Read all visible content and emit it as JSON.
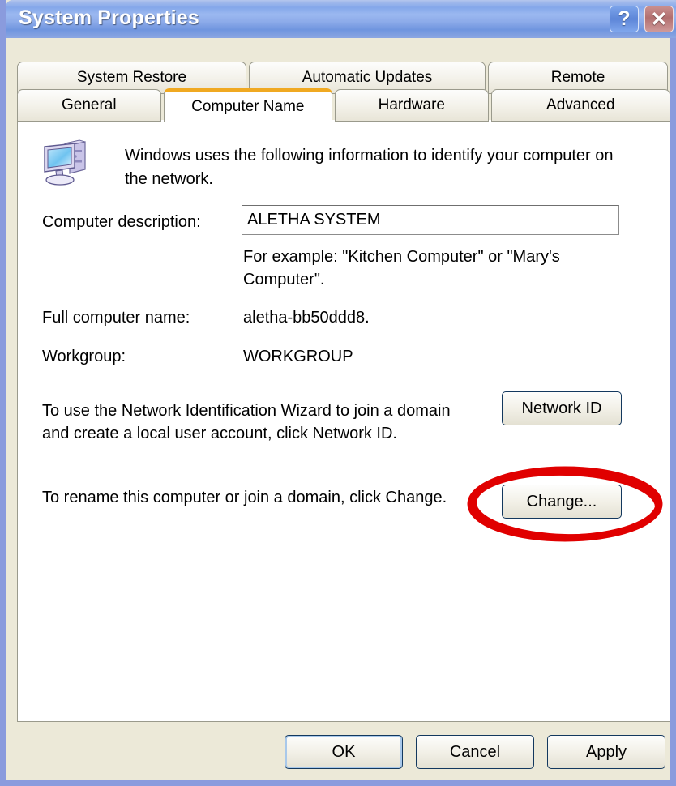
{
  "window": {
    "title": "System Properties",
    "help_button": "?",
    "close_button": "✕",
    "border_color": "#8a9bdd",
    "titlebar_color": "#7ea2e8",
    "body_color": "#ece9d8"
  },
  "tabs": {
    "active": "Computer Name",
    "active_underline_color": "#f0a921",
    "row_top": [
      {
        "label": "System Restore"
      },
      {
        "label": "Automatic Updates"
      },
      {
        "label": "Remote"
      }
    ],
    "row_bottom": [
      {
        "label": "General"
      },
      {
        "label": "Computer Name"
      },
      {
        "label": "Hardware"
      },
      {
        "label": "Advanced"
      }
    ]
  },
  "panel": {
    "icon": "computer-icon",
    "intro": "Windows uses the following information to identify your computer on the network.",
    "computer_description": {
      "label": "Computer description:",
      "value": "ALETHA SYSTEM",
      "placeholder": "",
      "hint": "For example: \"Kitchen Computer\" or \"Mary's Computer\"."
    },
    "full_computer_name": {
      "label": "Full computer name:",
      "value": "aletha-bb50ddd8."
    },
    "workgroup": {
      "label": "Workgroup:",
      "value": "WORKGROUP"
    },
    "network_id": {
      "text": "To use the Network Identification Wizard to join a domain and create a local user account, click Network ID.",
      "button": "Network ID"
    },
    "rename": {
      "text": "To rename this computer or join a domain, click Change.",
      "button": "Change..."
    }
  },
  "annotation": {
    "shape": "ellipse",
    "color": "#e00000",
    "target": "Change... button"
  },
  "footer": {
    "ok": "OK",
    "cancel": "Cancel",
    "apply": "Apply"
  }
}
